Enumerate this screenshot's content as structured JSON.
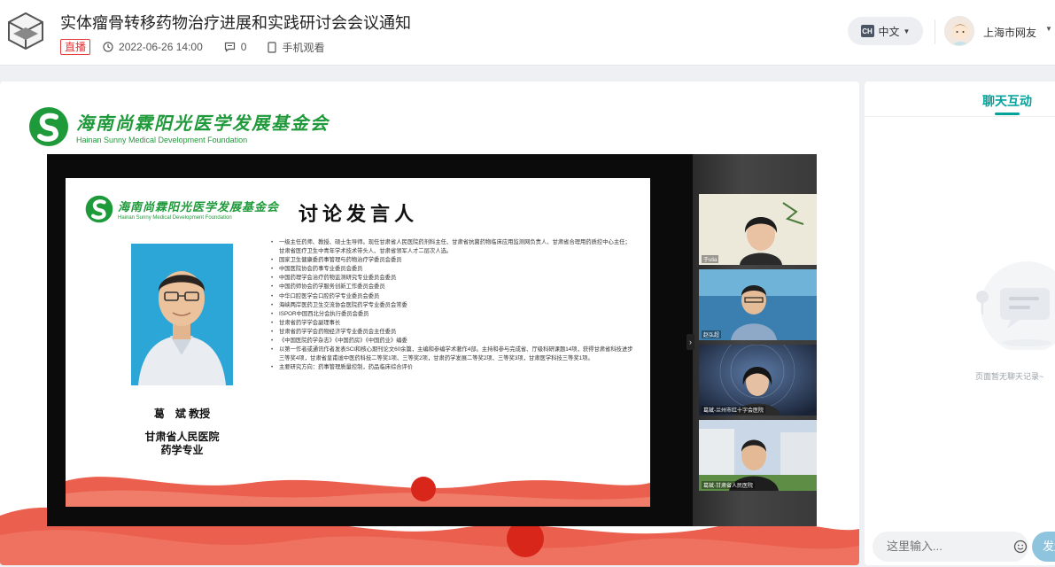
{
  "header": {
    "title": "实体瘤骨转移药物治疗进展和实践研讨会会议通知",
    "live_badge": "直播",
    "datetime": "2022-06-26 14:00",
    "comment_count": "0",
    "mobile_watch": "手机观看",
    "language": "中文",
    "language_flag": "CH",
    "username": "上海市网友"
  },
  "video": {
    "foundation_name_cn": "海南尚霖阳光医学发展基金会",
    "foundation_name_en": "Hainan Sunny Medical Development Foundation",
    "slide": {
      "title": "讨论发言人",
      "speaker_name": "葛　斌 教授",
      "speaker_org_line1": "甘肃省人民医院",
      "speaker_org_line2": "药学专业",
      "bullets": [
        "一级主任药师、教授、硕士生导师。现任甘肃省人民医院药剂科主任、甘肃省抗菌药物临床应用监测网负责人、甘肃省合理用药质控中心主任；甘肃省医疗卫生中青年学术技术带头人、甘肃省领军人才二层次人选。",
        "国家卫生健康委药事管理与药物治疗学委员会委员",
        "中国医院协会药事专业委员会委员",
        "中国药理学会治疗药物监测研究专业委员会委员",
        "中国药师协会药学服务创新工作委员会委员",
        "中华口腔医学会口腔药学专业委员会委员",
        "海峡两岸医药卫生交流协会医院药学专业委员会常委",
        "ISPOR中国西北分会执行委员会委员",
        "甘肃省药学学会副理事长",
        "甘肃省药学学会药物经济学专业委员会主任委员",
        "《中国医院药学杂志》《中国药房》《中国药业》编委",
        "以第一作者或通讯作者发表SCI和核心期刊论文60余篇，主编和参编学术著作4部。主持和参与完成省、厅级科研课题14项，获得甘肃省科技进步三等奖4项，甘肃省皇甫谧中医药科技二等奖1项、三等奖2项，甘肃药学发展二等奖2项、三等奖3项，甘肃医学科技三等奖1项。",
        "主要研究方向：药事管理质量控制，药品临床综合评价"
      ]
    },
    "participants": [
      {
        "label": "于ulia"
      },
      {
        "label": "赵弘超"
      },
      {
        "label": "葛斌-兰州市红十字会医院"
      },
      {
        "label": "葛斌-甘肃省人民医院"
      }
    ]
  },
  "chat": {
    "tab_label": "聊天互动",
    "empty_text": "页面暂无聊天记录~",
    "input_placeholder": "这里输入...",
    "send_label": "发送"
  },
  "colors": {
    "accent": "#00a39b",
    "live_red": "#e43c3c",
    "foundation_green": "#1f9a3a"
  }
}
